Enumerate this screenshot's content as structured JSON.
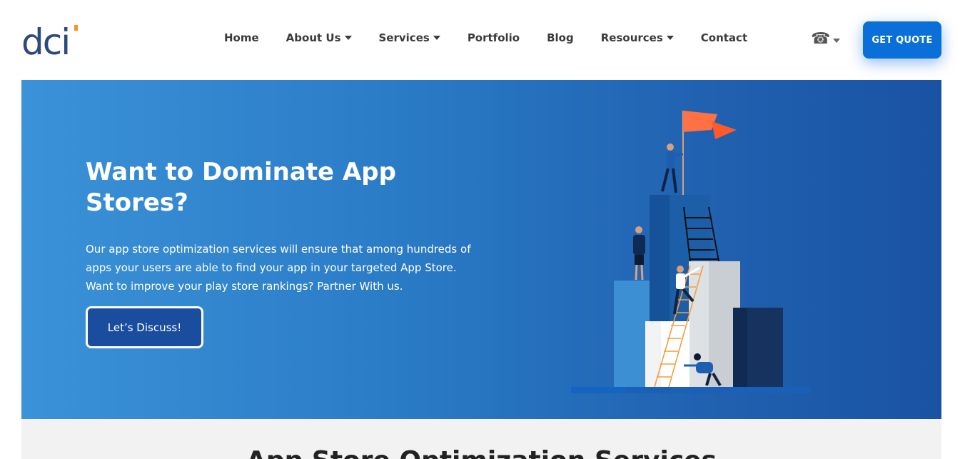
{
  "header": {
    "logo_text": "dci",
    "nav": [
      {
        "label": "Home",
        "dropdown": false
      },
      {
        "label": "About Us",
        "dropdown": true
      },
      {
        "label": "Services",
        "dropdown": true
      },
      {
        "label": "Portfolio",
        "dropdown": false
      },
      {
        "label": "Blog",
        "dropdown": false
      },
      {
        "label": "Resources",
        "dropdown": true
      },
      {
        "label": "Contact",
        "dropdown": false
      }
    ],
    "phone_icon": "phone-icon",
    "quote_label": "GET QUOTE"
  },
  "hero": {
    "title": "Want to Dominate App Stores?",
    "description": "Our app store optimization services will ensure that among hundreds of apps your users are able to find your app in your targeted App Store. Want to improve your play store rankings? Partner With us.",
    "button_label": "Let’s Discuss!"
  },
  "section2": {
    "title": "App Store Optimization Services"
  },
  "colors": {
    "accent": "#0a6fd8",
    "hero_start": "#3b92d8",
    "hero_end": "#1a52a3",
    "flag": "#ff7043",
    "button_dark": "#1a4d9e"
  }
}
